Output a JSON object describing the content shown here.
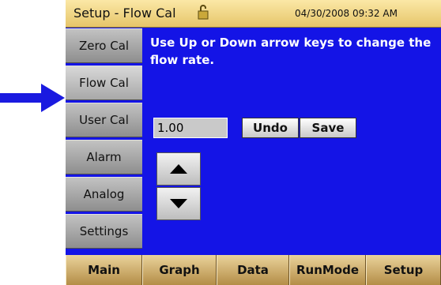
{
  "titlebar": {
    "title": "Setup - Flow Cal",
    "datetime": "04/30/2008 09:32 AM"
  },
  "sidebar": {
    "items": [
      {
        "label": "Zero Cal"
      },
      {
        "label": "Flow Cal",
        "active": true
      },
      {
        "label": "User Cal"
      },
      {
        "label": "Alarm"
      },
      {
        "label": "Analog"
      },
      {
        "label": "Settings"
      }
    ]
  },
  "content": {
    "instructions": "Use Up or Down arrow keys to change the flow rate.",
    "flow_value": "1.00",
    "undo_label": "Undo",
    "save_label": "Save"
  },
  "tabs": [
    "Main",
    "Graph",
    "Data",
    "RunMode",
    "Setup"
  ],
  "colors": {
    "screen_bg": "#1414e6",
    "pointer_arrow": "#1a1ae0",
    "tab_gold": "#d9b86e"
  }
}
